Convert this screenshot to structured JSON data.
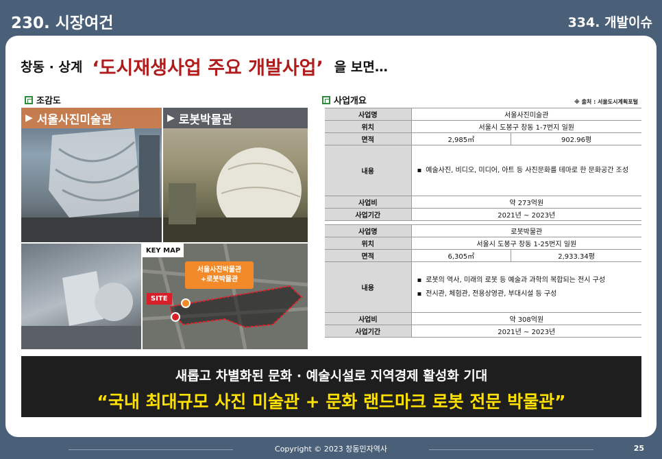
{
  "header": {
    "left": "230. 시장여건",
    "right": "334. 개발이슈"
  },
  "headline": {
    "lead": "창동 · 상계",
    "highlight": "‘도시재생사업 주요 개발사업’",
    "tail": "을 보면…"
  },
  "left_section": {
    "title": "조감도",
    "panel1": "서울사진미술관",
    "panel2": "로봇박물관",
    "keymap": "KEY MAP",
    "callout_line1": "서울사진박물관",
    "callout_line2": "+로봇박물관",
    "site": "SITE"
  },
  "right_section": {
    "title": "사업개요",
    "source": "※ 출처 : 서울도시계획포털"
  },
  "project1": {
    "name_key": "사업명",
    "name": "서울사진미술관",
    "loc_key": "위치",
    "loc": "서울시 도봉구 창동 1-7번지 일원",
    "area_key": "면적",
    "area_m2": "2,985㎡",
    "area_py": "902.96평",
    "content_key": "내용",
    "content": [
      "예술사진, 비디오, 미디어, 아트 등 사진문화를 테마로 한 문화공간 조성"
    ],
    "cost_key": "사업비",
    "cost": "약 273억원",
    "period_key": "사업기간",
    "period": "2021년 ~ 2023년"
  },
  "project2": {
    "name_key": "사업명",
    "name": "로봇박물관",
    "loc_key": "위치",
    "loc": "서울시 도봉구 창동 1-25번지 일원",
    "area_key": "면적",
    "area_m2": "6,305㎡",
    "area_py": "2,933.34평",
    "content_key": "내용",
    "content": [
      "로봇의 역사, 미래의 로봇 등 예술과 과학의 복합되는 전시 구성",
      "전시관, 체험관, 전용상영관, 부대시설 등 구성"
    ],
    "cost_key": "사업비",
    "cost": "약 308억원",
    "period_key": "사업기간",
    "period": "2021년 ~ 2023년"
  },
  "banner": {
    "line1": "새롭고 차별화된 문화 · 예술시설로 지역경제 활성화 기대",
    "line2": "“국내 최대규모 사진 미술관 + 문화 랜드마크 로봇 전문 박물관”"
  },
  "footer": {
    "copyright": "Copyright © 2023 창동민자역사",
    "page": "25"
  }
}
